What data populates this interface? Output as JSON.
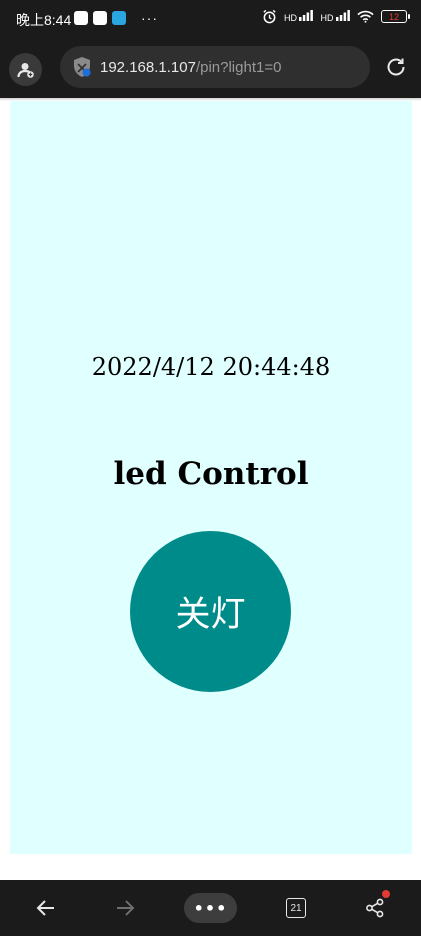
{
  "status_bar": {
    "time": "晚上8:44",
    "more": "···",
    "network_1": "HD",
    "network_2": "HD",
    "battery": "12"
  },
  "browser": {
    "url_host": "192.168.1.107",
    "url_path": "/pin?light1=0"
  },
  "page": {
    "datetime": "2022/4/12 20:44:48",
    "title": "led Control",
    "button_label": "关灯"
  },
  "bottom_nav": {
    "menu": "•••",
    "tab_count": "21"
  },
  "colors": {
    "page_background": "#e0ffff",
    "button": "#008b8b",
    "chrome": "#1b1b1b"
  }
}
